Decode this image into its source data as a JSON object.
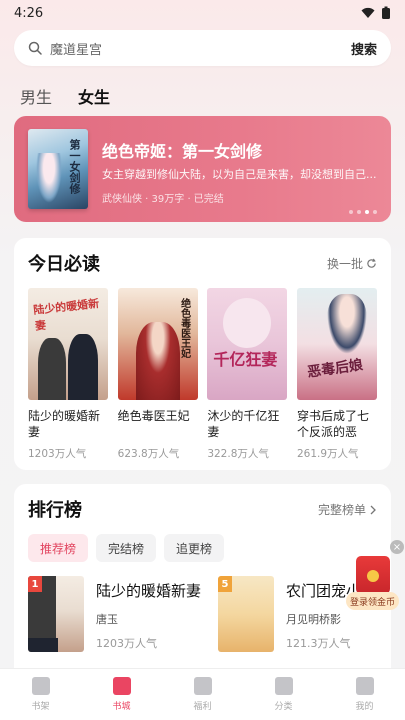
{
  "status_bar": {
    "time": "4:26"
  },
  "search": {
    "placeholder": "魔道星宫",
    "button_label": "搜索"
  },
  "gender_tabs": [
    {
      "label": "男生",
      "active": false
    },
    {
      "label": "女生",
      "active": true
    }
  ],
  "banner": {
    "cover_text": "第一女剑修",
    "title": "绝色帝姬：第一女剑修",
    "description": "女主穿越到修仙大陆，以为自己是来害，却没想到自己...",
    "meta": "武侠仙侠 · 39万字 · 已完结",
    "active_dot": 3,
    "dot_count": 4
  },
  "today": {
    "title": "今日必读",
    "action_label": "换一批",
    "books": [
      {
        "title": "陆少的暖婚新妻",
        "popularity": "1203万人气",
        "cover_text": "陆少的暖婚新妻"
      },
      {
        "title": "绝色毒医王妃",
        "popularity": "623.8万人气",
        "cover_text": "绝色毒医王妃"
      },
      {
        "title": "沐少的千亿狂妻",
        "popularity": "322.8万人气",
        "cover_text": "千亿狂妻"
      },
      {
        "title": "穿书后成了七个反派的恶毒...",
        "popularity": "261.9万人气",
        "cover_text": "恶毒后娘"
      }
    ]
  },
  "ranking": {
    "title": "排行榜",
    "action_label": "完整榜单",
    "tabs": [
      {
        "label": "推荐榜",
        "active": true
      },
      {
        "label": "完结榜",
        "active": false
      },
      {
        "label": "追更榜",
        "active": false
      }
    ],
    "items": [
      {
        "rank": "1",
        "title": "陆少的暖婚新妻",
        "author": "唐玉",
        "popularity": "1203万人气",
        "rank_color": "#e8473d"
      },
      {
        "rank": "5",
        "title": "农门团宠小福包",
        "author": "月见明桥影",
        "popularity": "121.3万人气",
        "rank_color": "#f0a33a"
      }
    ]
  },
  "float_badge": {
    "label": "登录领金币",
    "close_symbol": "×"
  },
  "bottom_nav": [
    {
      "label": "书架",
      "icon": "bookshelf-icon",
      "active": false
    },
    {
      "label": "书城",
      "icon": "bookstore-icon",
      "active": true
    },
    {
      "label": "福利",
      "icon": "gift-icon",
      "active": false
    },
    {
      "label": "分类",
      "icon": "category-icon",
      "active": false
    },
    {
      "label": "我的",
      "icon": "profile-icon",
      "active": false
    }
  ],
  "colors": {
    "accent": "#ea4562",
    "banner": "#e06b7f",
    "rank_tab_active_bg": "#fde8ec"
  }
}
